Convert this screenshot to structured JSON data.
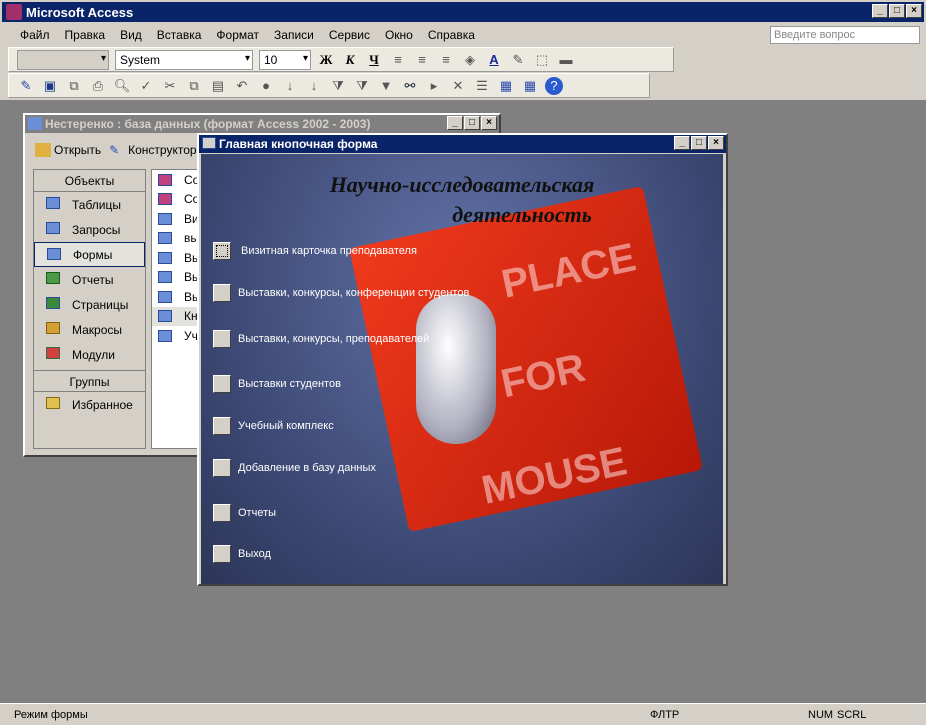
{
  "app": {
    "title": "Microsoft Access"
  },
  "menu": [
    "Файл",
    "Правка",
    "Вид",
    "Вставка",
    "Формат",
    "Записи",
    "Сервис",
    "Окно",
    "Справка"
  ],
  "help_placeholder": "Введите вопрос",
  "format_toolbar": {
    "object_combo": "",
    "font": "System",
    "size": "10",
    "bold": "Ж",
    "italic": "К",
    "underline": "Ч"
  },
  "db_window": {
    "title": "Нестеренко : база данных (формат Access 2002 - 2003)",
    "open": "Открыть",
    "design": "Конструктор",
    "objects_header": "Объекты",
    "objects": [
      "Таблицы",
      "Запросы",
      "Формы",
      "Отчеты",
      "Страницы",
      "Макросы",
      "Модули"
    ],
    "groups_header": "Группы",
    "groups": [
      "Избранное"
    ],
    "list": [
      "Со",
      "Со",
      "Ви",
      "вы",
      "Вы",
      "Вы",
      "Вы",
      "Кн",
      "Уч"
    ]
  },
  "switchboard": {
    "title": "Главная кнопочная форма",
    "heading1": "Научно-исследовательская",
    "heading2": "деятельность",
    "poster_text": [
      "PLACE",
      "FOR",
      "MOUSE"
    ],
    "buttons": [
      "Визитная карточка преподавателя",
      "Выставки, конкурсы, конференции студентов",
      "Выставки, конкурсы, преподавателей",
      "Выставки студентов",
      "Учебный комплекс",
      "Добавление в базу данных",
      "Отчеты",
      "Выход"
    ]
  },
  "status": {
    "mode": "Режим формы",
    "filter": "ФЛТР",
    "num": "NUM",
    "scrl": "SCRL"
  }
}
